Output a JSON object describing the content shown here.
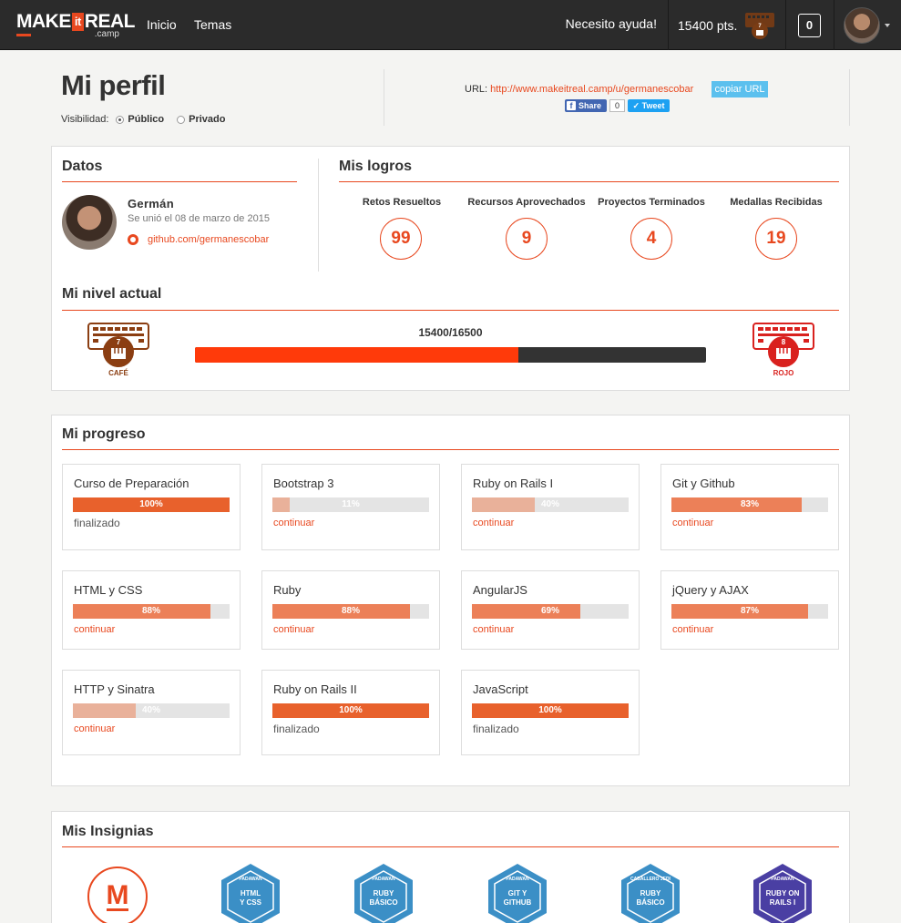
{
  "nav": {
    "logo_make": "MAKE",
    "logo_it": "it",
    "logo_real": "REAL",
    "logo_camp": ".camp",
    "links": [
      "Inicio",
      "Temas"
    ],
    "help": "Necesito ayuda!",
    "points": "15400 pts.",
    "coffee_level": "7",
    "notifications": "0"
  },
  "profile": {
    "title": "Mi perfil",
    "visibility_label": "Visibilidad:",
    "visibility_public": "Público",
    "visibility_private": "Privado",
    "url_label": "URL:",
    "url": "http://www.makeitreal.camp/u/germanescobar",
    "copy_label": "copiar URL",
    "share_label": "Share",
    "share_count": "0",
    "tweet_label": "Tweet"
  },
  "datos": {
    "title": "Datos",
    "name": "Germán",
    "since": "Se unió el 08 de marzo de 2015",
    "github": "github.com/germanescobar"
  },
  "logros": {
    "title": "Mis logros",
    "stats": [
      {
        "label": "Retos Resueltos",
        "value": "99"
      },
      {
        "label": "Recursos Aprovechados",
        "value": "9"
      },
      {
        "label": "Proyectos Terminados",
        "value": "4"
      },
      {
        "label": "Medallas Recibidas",
        "value": "19"
      }
    ]
  },
  "nivel": {
    "title": "Mi nivel actual",
    "progress_text": "15400/16500",
    "progress": 0.6333,
    "current": {
      "num": "7",
      "name": "CAFÉ",
      "color": "#8b3e12"
    },
    "next": {
      "num": "8",
      "name": "ROJO",
      "color": "#d9211e"
    }
  },
  "progreso": {
    "title": "Mi progreso",
    "continue_label": "continuar",
    "done_label": "finalizado",
    "courses": [
      {
        "name": "Curso de Preparación",
        "pct": 100,
        "pct_label": "100%",
        "status": "finalizado"
      },
      {
        "name": "Bootstrap 3",
        "pct": 11,
        "pct_label": "11%",
        "status": "continuar"
      },
      {
        "name": "Ruby on Rails I",
        "pct": 40,
        "pct_label": "40%",
        "status": "continuar"
      },
      {
        "name": "Git y Github",
        "pct": 83,
        "pct_label": "83%",
        "status": "continuar"
      },
      {
        "name": "HTML y CSS",
        "pct": 88,
        "pct_label": "88%",
        "status": "continuar"
      },
      {
        "name": "Ruby",
        "pct": 88,
        "pct_label": "88%",
        "status": "continuar"
      },
      {
        "name": "AngularJS",
        "pct": 69,
        "pct_label": "69%",
        "status": "continuar"
      },
      {
        "name": "jQuery y AJAX",
        "pct": 87,
        "pct_label": "87%",
        "status": "continuar"
      },
      {
        "name": "HTTP y Sinatra",
        "pct": 40,
        "pct_label": "40%",
        "status": "continuar"
      },
      {
        "name": "Ruby on Rails II",
        "pct": 100,
        "pct_label": "100%",
        "status": "finalizado"
      },
      {
        "name": "JavaScript",
        "pct": 100,
        "pct_label": "100%",
        "status": "finalizado"
      }
    ]
  },
  "insignias": {
    "title": "Mis Insignias",
    "badges": [
      {
        "type": "logo",
        "mark": "M",
        "color": "#e8481f"
      },
      {
        "type": "hex",
        "rank": "PADAWAN",
        "lines": [
          "HTML",
          "Y CSS"
        ],
        "color": "#3b8fc6"
      },
      {
        "type": "hex",
        "rank": "PADAWAN",
        "lines": [
          "RUBY",
          "BÁSICO"
        ],
        "color": "#3b8fc6"
      },
      {
        "type": "hex",
        "rank": "PADAWAN",
        "lines": [
          "GIT Y",
          "GITHUB"
        ],
        "color": "#3b8fc6"
      },
      {
        "type": "hex",
        "rank": "CABALLERO JEDI",
        "lines": [
          "RUBY",
          "BÁSICO"
        ],
        "color": "#3b8fc6"
      },
      {
        "type": "hex",
        "rank": "PADAWAN",
        "lines": [
          "RUBY ON",
          "RAILS I"
        ],
        "color": "#4a3fa3"
      }
    ]
  }
}
